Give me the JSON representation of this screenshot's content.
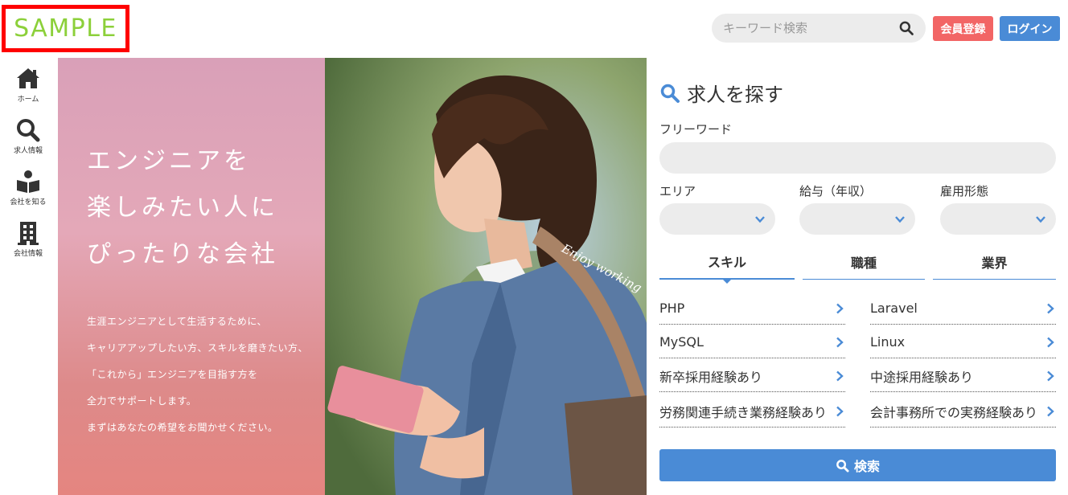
{
  "header": {
    "logo": "SAMPLE",
    "search_placeholder": "キーワード検索",
    "register": "会員登録",
    "login": "ログイン"
  },
  "sidenav": [
    {
      "label": "ホーム",
      "icon": "home-icon"
    },
    {
      "label": "求人情報",
      "icon": "search-icon"
    },
    {
      "label": "会社を知る",
      "icon": "reader-icon"
    },
    {
      "label": "会社情報",
      "icon": "building-icon"
    }
  ],
  "hero": {
    "headline": [
      "エンジニアを",
      "楽しみたい人に",
      "ぴったりな会社"
    ],
    "body": [
      "生涯エンジニアとして生活するために、",
      "キャリアアップしたい方、スキルを磨きたい方、",
      "「これから」エンジニアを目指す方を",
      "全力でサポートします。",
      "まずはあなたの希望をお聞かせください。"
    ],
    "tagline": "Enjoy working"
  },
  "panel": {
    "title": "求人を探す",
    "freeword_label": "フリーワード",
    "area_label": "エリア",
    "salary_label": "給与（年収）",
    "employment_label": "雇用形態",
    "tabs": [
      "スキル",
      "職種",
      "業界"
    ],
    "active_tab": "スキル",
    "skills": [
      "PHP",
      "Laravel",
      "MySQL",
      "Linux",
      "新卒採用経験あり",
      "中途採用経験あり",
      "労務関連手続き業務経験あり",
      "会計事務所での実務経験あり"
    ],
    "search_button": "検索"
  },
  "colors": {
    "accent": "#4a8bd6",
    "register": "#f26565",
    "logo": "#8cd03a",
    "logo_border": "#ff0000"
  }
}
